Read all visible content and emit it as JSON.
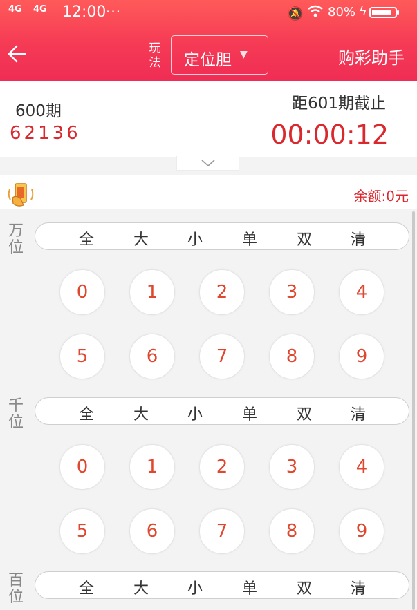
{
  "status_bar": {
    "signal1": "4G",
    "signal2": "4G",
    "time": "12:00",
    "dots": "···",
    "battery_pct": "80%"
  },
  "header": {
    "play_label": "玩法",
    "mode": "定位胆",
    "helper": "购彩助手"
  },
  "draw": {
    "period": "600期",
    "result": "62136",
    "deadline_label": "距601期截止",
    "countdown": "00:00:12"
  },
  "balance": "余额:0元",
  "filters": [
    "全",
    "大",
    "小",
    "单",
    "双",
    "清"
  ],
  "digits": [
    "0",
    "1",
    "2",
    "3",
    "4",
    "5",
    "6",
    "7",
    "8",
    "9"
  ],
  "positions": [
    {
      "label": "万位"
    },
    {
      "label": "千位"
    },
    {
      "label": "百位"
    }
  ],
  "colors": {
    "primary": "#f53a55",
    "accent_red": "#d9292f",
    "ball_text": "#e0472f"
  }
}
